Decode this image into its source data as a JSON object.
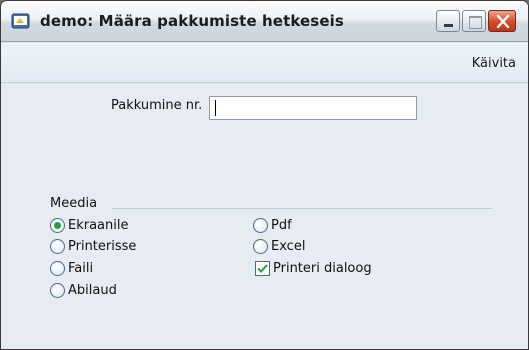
{
  "window": {
    "title": "demo: Määra pakkumiste hetkeseis",
    "icons": [
      "app-icon",
      "minimize-icon",
      "maximize-icon",
      "close-icon"
    ]
  },
  "menu": {
    "run_label": "Käivita"
  },
  "form": {
    "number_label": "Pakkumine nr.",
    "number_value": ""
  },
  "media": {
    "title": "Meedia",
    "options": {
      "ekraanile": "Ekraanile",
      "printerisse": "Printerisse",
      "faili": "Faili",
      "abilaud": "Abilaud",
      "pdf": "Pdf",
      "excel": "Excel"
    },
    "selected": "Ekraanile",
    "printer_dialog_label": "Printeri dialoog",
    "printer_dialog_checked": true
  },
  "colors": {
    "accent_check": "#2a9d3a",
    "close_button": "#d8472a"
  }
}
